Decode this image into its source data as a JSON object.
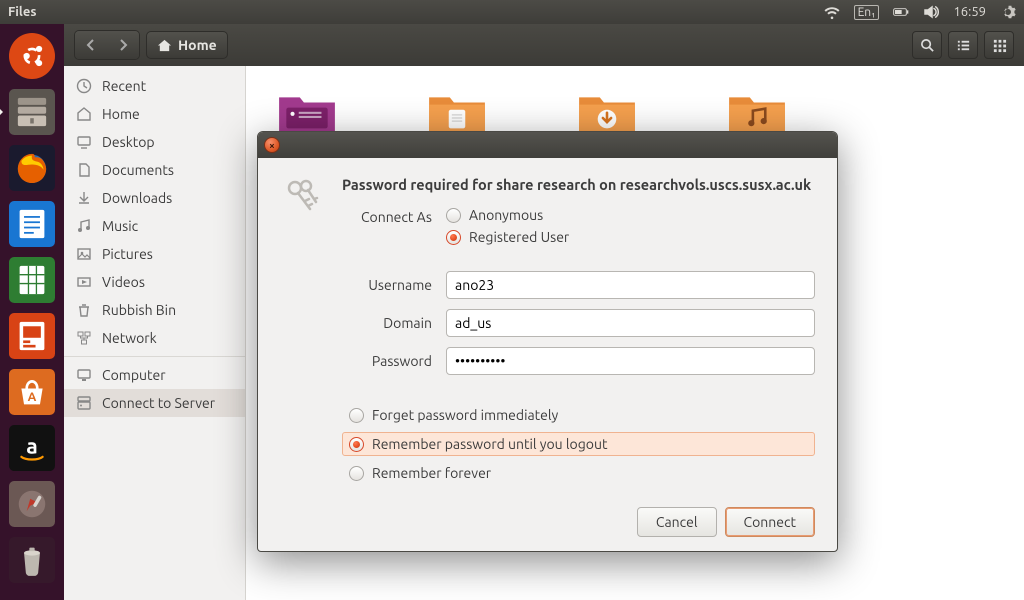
{
  "topbar": {
    "appname": "Files",
    "lang": "En₁",
    "time": "16:59"
  },
  "toolbar": {
    "path_label": "Home"
  },
  "sidebar": {
    "items": [
      {
        "label": "Recent",
        "icon": "clock"
      },
      {
        "label": "Home",
        "icon": "home"
      },
      {
        "label": "Desktop",
        "icon": "desktop"
      },
      {
        "label": "Documents",
        "icon": "document"
      },
      {
        "label": "Downloads",
        "icon": "download"
      },
      {
        "label": "Music",
        "icon": "music"
      },
      {
        "label": "Pictures",
        "icon": "picture"
      },
      {
        "label": "Videos",
        "icon": "video"
      },
      {
        "label": "Rubbish Bin",
        "icon": "trash"
      },
      {
        "label": "Network",
        "icon": "network"
      }
    ],
    "items2": [
      {
        "label": "Computer",
        "icon": "computer"
      },
      {
        "label": "Connect to Server",
        "icon": "server"
      }
    ]
  },
  "dialog": {
    "title": "Password required for share research on researchvols.uscs.susx.ac.uk",
    "connect_as_label": "Connect As",
    "anon_label": "Anonymous",
    "reg_label": "Registered User",
    "username_label": "Username",
    "username_value": "ano23",
    "domain_label": "Domain",
    "domain_value": "ad_us",
    "password_label": "Password",
    "password_value": "••••••••••",
    "opt_forget": "Forget password immediately",
    "opt_session": "Remember password until you logout",
    "opt_forever": "Remember forever",
    "cancel": "Cancel",
    "connect": "Connect"
  }
}
